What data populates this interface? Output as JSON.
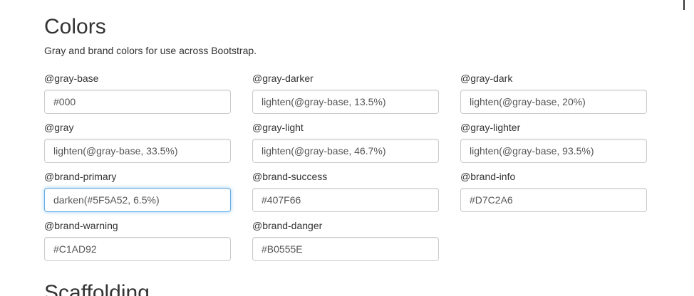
{
  "section": {
    "title": "Colors",
    "description": "Gray and brand colors for use across Bootstrap."
  },
  "variables": [
    {
      "name": "@gray-base",
      "value": "#000"
    },
    {
      "name": "@gray-darker",
      "value": "lighten(@gray-base, 13.5%)"
    },
    {
      "name": "@gray-dark",
      "value": "lighten(@gray-base, 20%)"
    },
    {
      "name": "@gray",
      "value": "lighten(@gray-base, 33.5%)"
    },
    {
      "name": "@gray-light",
      "value": "lighten(@gray-base, 46.7%)"
    },
    {
      "name": "@gray-lighter",
      "value": "lighten(@gray-base, 93.5%)"
    },
    {
      "name": "@brand-primary",
      "value": "darken(#5F5A52, 6.5%)",
      "focused": true
    },
    {
      "name": "@brand-success",
      "value": "#407F66"
    },
    {
      "name": "@brand-info",
      "value": "#D7C2A6"
    },
    {
      "name": "@brand-warning",
      "value": "#C1AD92"
    },
    {
      "name": "@brand-danger",
      "value": "#B0555E"
    }
  ],
  "next_section": {
    "title": "Scaffolding"
  },
  "colors": {
    "text": "#333333",
    "input_text": "#555555",
    "input_border": "#cccccc",
    "focus_border": "#66afe9"
  }
}
